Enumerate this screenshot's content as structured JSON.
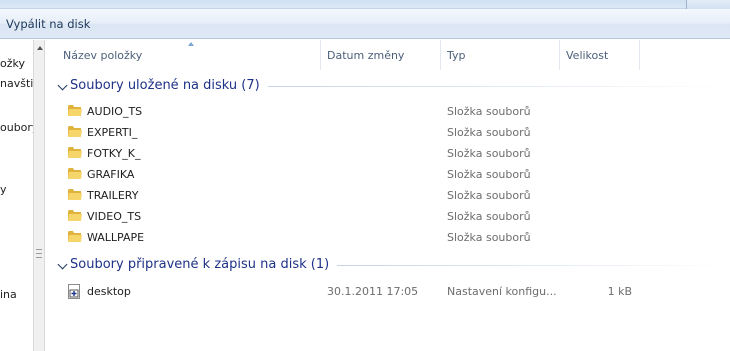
{
  "toolbar": {
    "burn_label": "Vypálit na disk"
  },
  "nav": {
    "items": [
      "ožky",
      "navšti",
      "oubory",
      "y",
      "ina"
    ]
  },
  "columns": {
    "name": "Název položky",
    "date": "Datum změny",
    "type": "Typ",
    "size": "Velikost"
  },
  "groups": [
    {
      "title": "Soubory uložené na disku (7)",
      "items": [
        {
          "name": "AUDIO_TS",
          "date": "",
          "type": "Složka souborů",
          "size": "",
          "icon": "folder-icon"
        },
        {
          "name": "EXPERTI_",
          "date": "",
          "type": "Složka souborů",
          "size": "",
          "icon": "folder-icon"
        },
        {
          "name": "FOTKY_K_",
          "date": "",
          "type": "Složka souborů",
          "size": "",
          "icon": "folder-icon"
        },
        {
          "name": "GRAFIKA",
          "date": "",
          "type": "Složka souborů",
          "size": "",
          "icon": "folder-icon"
        },
        {
          "name": "TRAILERY",
          "date": "",
          "type": "Složka souborů",
          "size": "",
          "icon": "folder-icon"
        },
        {
          "name": "VIDEO_TS",
          "date": "",
          "type": "Složka souborů",
          "size": "",
          "icon": "folder-icon"
        },
        {
          "name": "WALLPAPE",
          "date": "",
          "type": "Složka souborů",
          "size": "",
          "icon": "folder-icon"
        }
      ]
    },
    {
      "title": "Soubory připravené k zápisu na disk (1)",
      "items": [
        {
          "name": "desktop",
          "date": "30.1.2011 17:05",
          "type": "Nastavení konfigu...",
          "size": "1 kB",
          "icon": "settings-file-icon"
        }
      ]
    }
  ]
}
